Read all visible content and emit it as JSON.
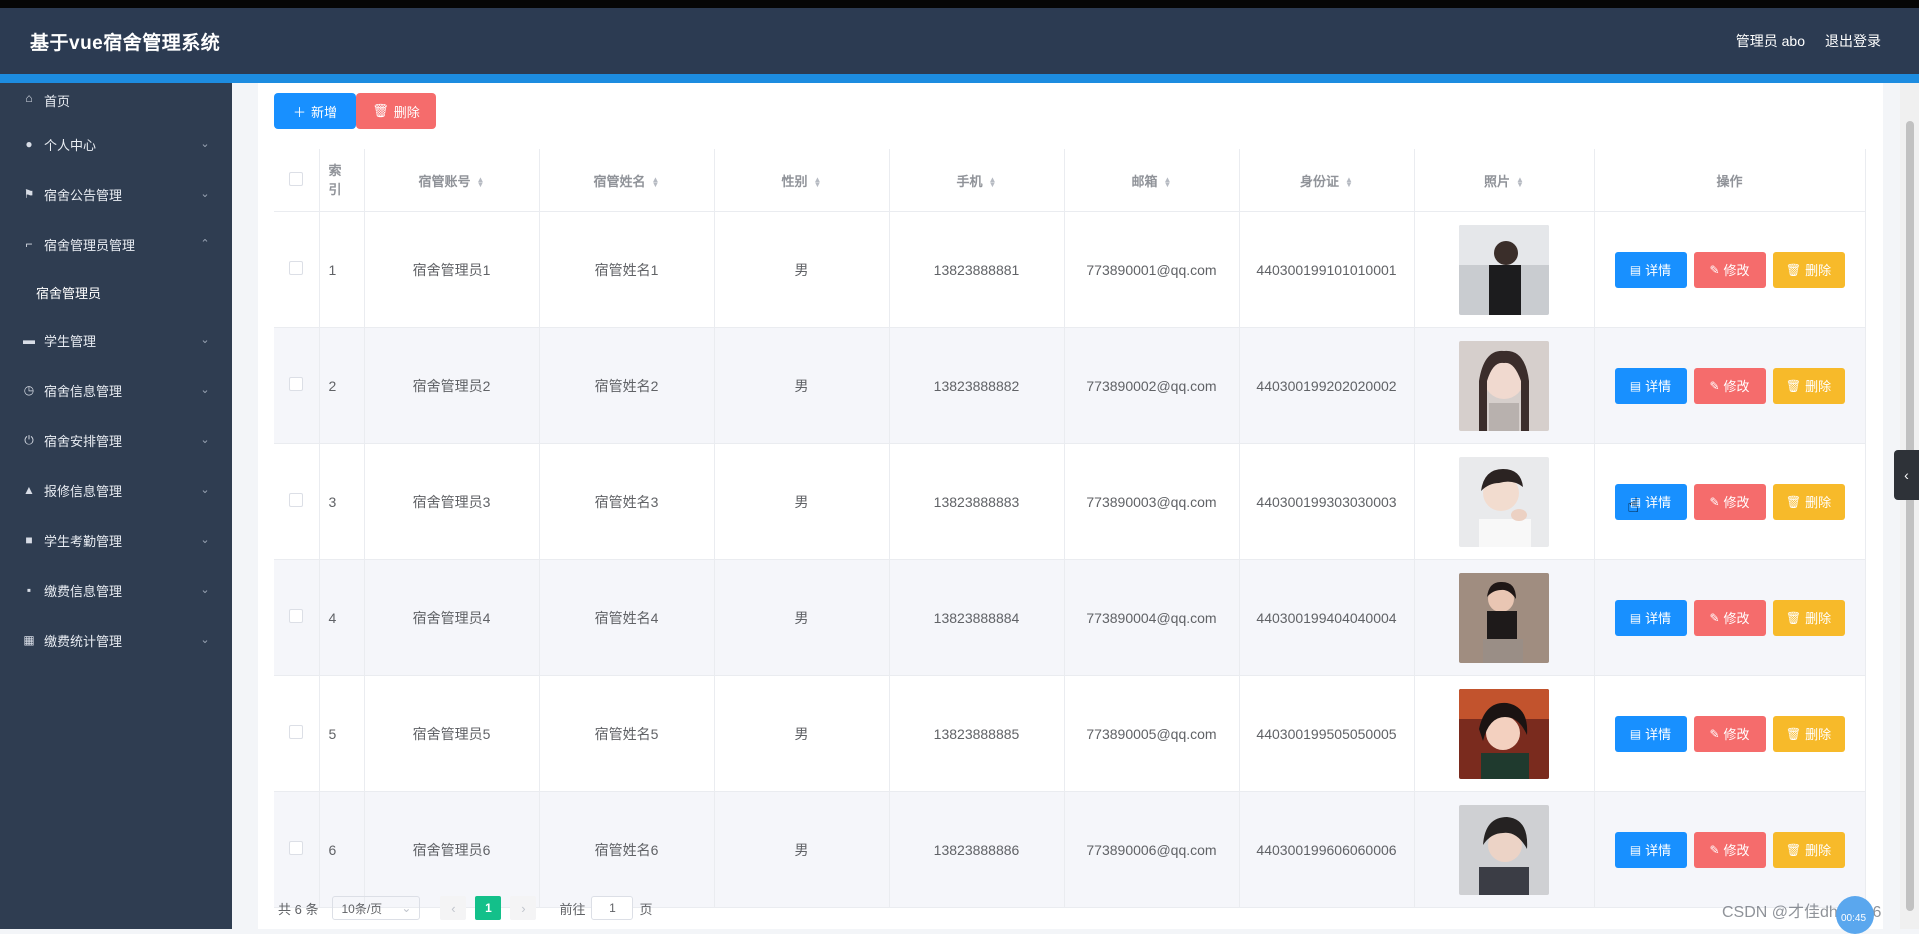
{
  "header": {
    "title": "基于vue宿舍管理系统",
    "admin_label": "管理员 abo",
    "logout_label": "退出登录"
  },
  "sidebar": {
    "items": [
      {
        "label": "首页",
        "icon": "home-icon"
      },
      {
        "label": "个人中心",
        "icon": "user-icon"
      },
      {
        "label": "宿舍公告管理",
        "icon": "flag-icon"
      },
      {
        "label": "宿舍管理员管理",
        "icon": "crop-icon"
      },
      {
        "label": "学生管理",
        "icon": "printer-icon"
      },
      {
        "label": "宿舍信息管理",
        "icon": "clock-icon"
      },
      {
        "label": "宿舍安排管理",
        "icon": "power-icon"
      },
      {
        "label": "报修信息管理",
        "icon": "thumb-icon"
      },
      {
        "label": "学生考勤管理",
        "icon": "briefcase-icon"
      },
      {
        "label": "缴费信息管理",
        "icon": "chat-icon"
      },
      {
        "label": "缴费统计管理",
        "icon": "grid-icon"
      }
    ],
    "submenu": {
      "label": "宿舍管理员"
    }
  },
  "toolbar": {
    "add_label": "新增",
    "delete_label": "删除"
  },
  "table": {
    "headers": {
      "index": "索引",
      "account": "宿管账号",
      "name": "宿管姓名",
      "gender": "性别",
      "phone": "手机",
      "email": "邮箱",
      "idcard": "身份证",
      "photo": "照片",
      "actions": "操作"
    },
    "rows": [
      {
        "index": "1",
        "account": "宿舍管理员1",
        "name": "宿管姓名1",
        "gender": "男",
        "phone": "13823888881",
        "email": "773890001@qq.com",
        "idcard": "440300199101010001"
      },
      {
        "index": "2",
        "account": "宿舍管理员2",
        "name": "宿管姓名2",
        "gender": "男",
        "phone": "13823888882",
        "email": "773890002@qq.com",
        "idcard": "440300199202020002"
      },
      {
        "index": "3",
        "account": "宿舍管理员3",
        "name": "宿管姓名3",
        "gender": "男",
        "phone": "13823888883",
        "email": "773890003@qq.com",
        "idcard": "440300199303030003"
      },
      {
        "index": "4",
        "account": "宿舍管理员4",
        "name": "宿管姓名4",
        "gender": "男",
        "phone": "13823888884",
        "email": "773890004@qq.com",
        "idcard": "440300199404040004"
      },
      {
        "index": "5",
        "account": "宿舍管理员5",
        "name": "宿管姓名5",
        "gender": "男",
        "phone": "13823888885",
        "email": "773890005@qq.com",
        "idcard": "440300199505050005"
      },
      {
        "index": "6",
        "account": "宿舍管理员6",
        "name": "宿管姓名6",
        "gender": "男",
        "phone": "13823888886",
        "email": "773890006@qq.com",
        "idcard": "440300199606060006"
      }
    ],
    "actions": {
      "detail": "详情",
      "edit": "修改",
      "delete": "删除"
    }
  },
  "pagination": {
    "total": "共 6 条",
    "page_size": "10条/页",
    "current_page": "1",
    "goto_label": "前往",
    "goto_value": "1",
    "page_unit": "页"
  },
  "watermark": "CSDN @才佳dhc8886",
  "badge_text": "00:45",
  "colors": {
    "header": "#2c3b52",
    "sidebar": "#2f3d51",
    "accent": "#1890ff",
    "danger": "#f56c6c",
    "warning": "#f7ba2a",
    "pager_active": "#13c08a"
  }
}
